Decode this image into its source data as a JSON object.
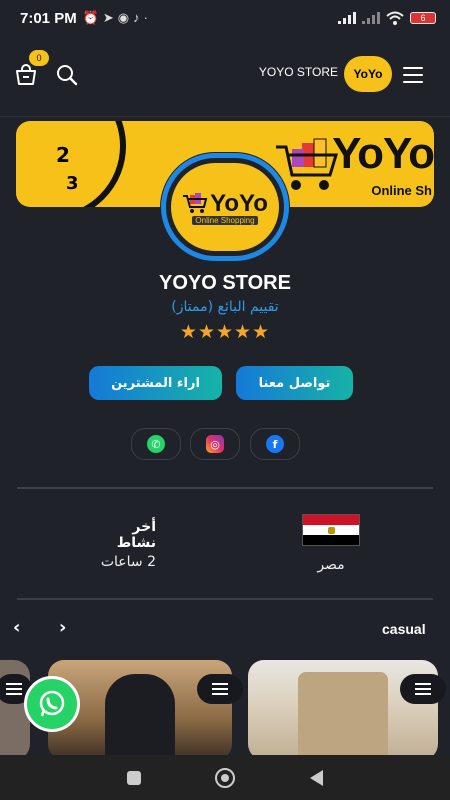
{
  "status_bar": {
    "time": "7:01 PM",
    "battery": "6",
    "left_icons": [
      "alarm-icon",
      "telegram-icon",
      "whatsapp-icon",
      "tiktok-icon"
    ],
    "right_icons": [
      "signal-icon",
      "signal-x-icon",
      "wifi-icon",
      "battery-icon"
    ]
  },
  "header": {
    "title": "YOYO STORE",
    "cart_count": "0",
    "logo_text": "YoYo"
  },
  "banner": {
    "brand": "YoYo",
    "subtitle": "Online Sh",
    "clock_digits": [
      "2",
      "3"
    ]
  },
  "profile": {
    "logo_text": "YoYo",
    "logo_subtitle": "Online Shopping"
  },
  "store": {
    "name": "YOYO STORE",
    "rating_label": "تقييم البائع (ممتاز)",
    "stars": "★★★★★",
    "rating_value": 5
  },
  "actions": {
    "contact": "تواصل معنا",
    "reviews": "اراء المشترين"
  },
  "social": [
    "whatsapp",
    "instagram",
    "facebook"
  ],
  "info": {
    "country": "مصر",
    "last_active_label": "أخر نشاط",
    "last_active_value": "2 ساعات"
  },
  "section": {
    "title": "casual",
    "prev": "‹",
    "next": "›"
  },
  "colors": {
    "accent": "#f6c21a",
    "primary": "#1e88e5",
    "background": "#1f2329",
    "star": "#f4a52a"
  }
}
